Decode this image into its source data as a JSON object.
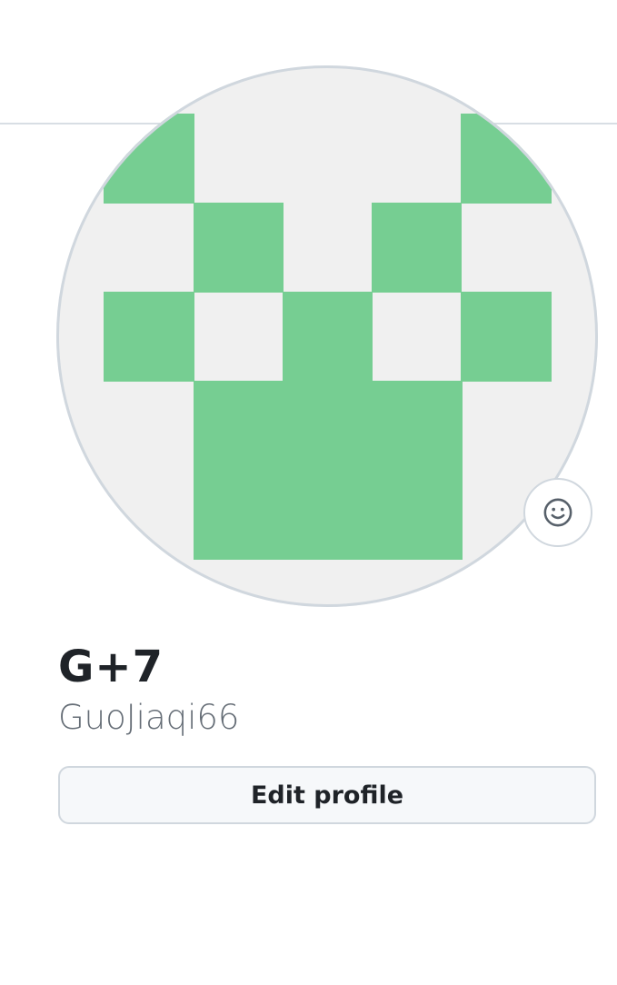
{
  "profile": {
    "display_name": "G+7",
    "username": "GuoJiaqi66",
    "edit_button_label": "Edit profile"
  },
  "avatar": {
    "icon": "identicon-avatar",
    "foreground_color": "#76ce92",
    "background_color": "#f0f0f0"
  },
  "status": {
    "icon": "smiley-icon"
  },
  "colors": {
    "text_primary": "#1f2328",
    "text_secondary": "#656d76",
    "border": "#d0d7de",
    "button_bg": "#f6f8fa"
  }
}
